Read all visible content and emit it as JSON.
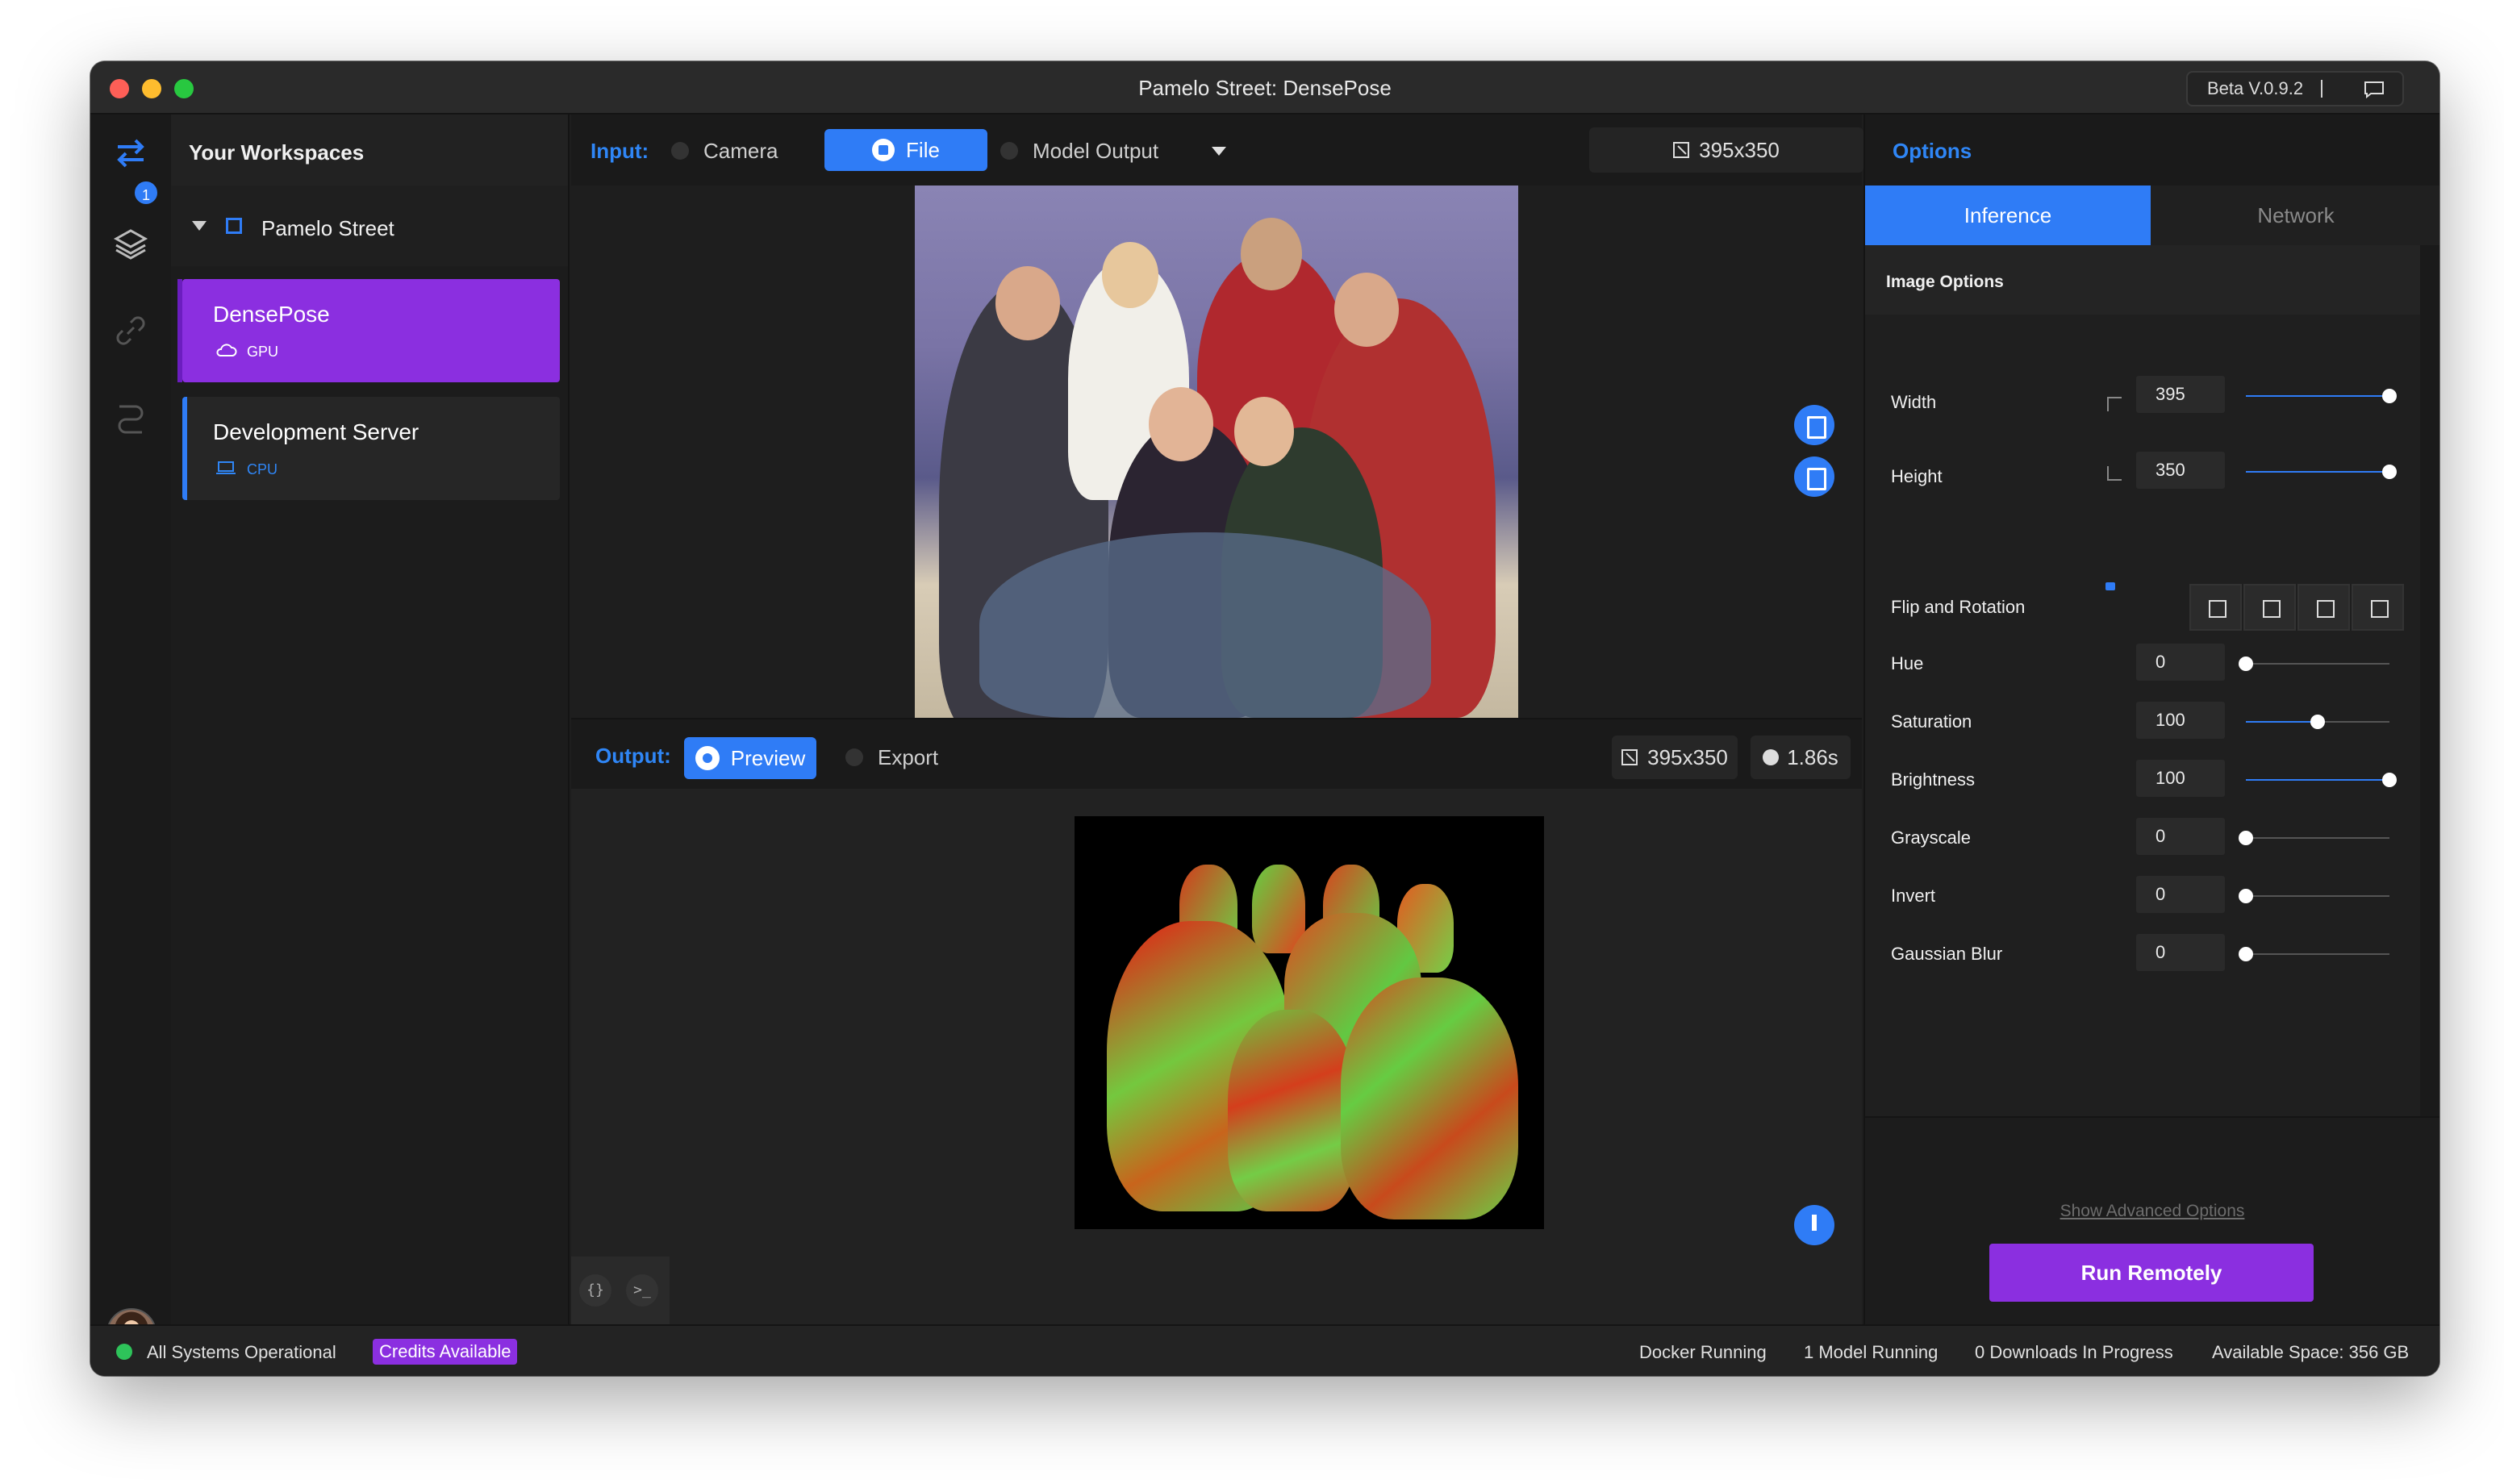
{
  "window": {
    "title": "Pamelo Street: DensePose",
    "version": "Beta V.0.9.2"
  },
  "rail": {
    "badge_count": "1"
  },
  "workspaces": {
    "title": "Your Workspaces",
    "group": "Pamelo Street",
    "items": [
      {
        "name": "DensePose",
        "sub": "GPU"
      },
      {
        "name": "Development Server",
        "sub": "CPU"
      }
    ]
  },
  "input": {
    "label": "Input:",
    "sources": [
      "Camera",
      "File",
      "Model Output"
    ],
    "active_source": "File",
    "size": "395x350"
  },
  "output": {
    "label": "Output:",
    "preview": "Preview",
    "export": "Export",
    "size": "395x350",
    "time": "1.86s"
  },
  "options": {
    "title": "Options",
    "tabs": [
      "Inference",
      "Network"
    ],
    "active_tab": "Inference",
    "section": "Image Options",
    "fields": {
      "width": {
        "label": "Width",
        "value": "395",
        "slider": 1.0
      },
      "height": {
        "label": "Height",
        "value": "350",
        "slider": 1.0
      },
      "flip": {
        "label": "Flip and Rotation"
      },
      "hue": {
        "label": "Hue",
        "value": "0",
        "slider": 0.0
      },
      "saturation": {
        "label": "Saturation",
        "value": "100",
        "slider": 0.5
      },
      "brightness": {
        "label": "Brightness",
        "value": "100",
        "slider": 1.0
      },
      "grayscale": {
        "label": "Grayscale",
        "value": "0",
        "slider": 0.0
      },
      "invert": {
        "label": "Invert",
        "value": "0",
        "slider": 0.0
      },
      "blur": {
        "label": "Gaussian Blur",
        "value": "0",
        "slider": 0.0
      }
    },
    "advanced": "Show Advanced Options",
    "run": "Run Remotely"
  },
  "status": {
    "systems": "All Systems Operational",
    "credits": "Credits Available",
    "docker": "Docker Running",
    "models": "1 Model Running",
    "downloads": "0 Downloads In Progress",
    "space": "Available Space: 356 GB"
  },
  "colors": {
    "accent": "#2f7cf6",
    "purple": "#8b2fe0",
    "ok": "#2ec35a"
  }
}
